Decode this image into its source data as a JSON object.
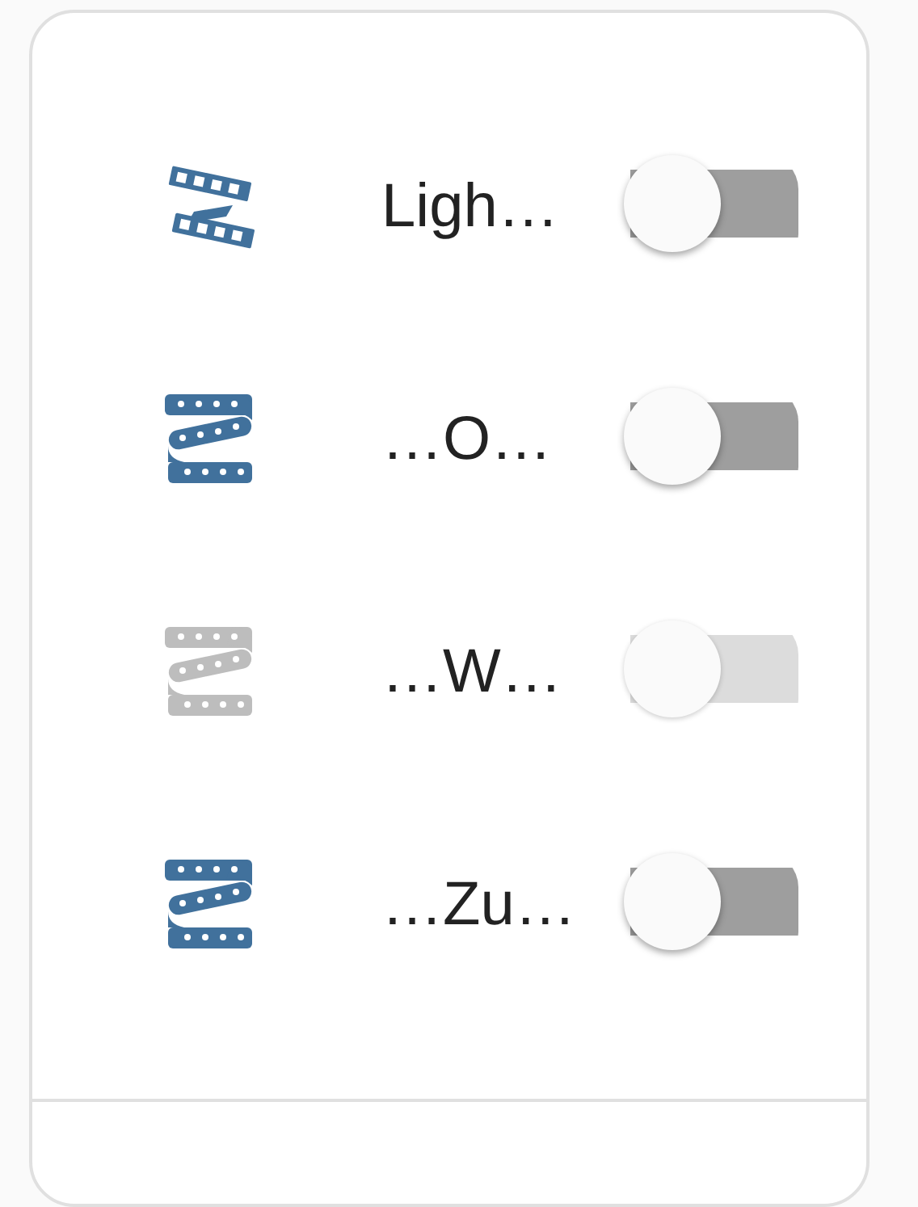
{
  "rows": [
    {
      "kind": "film",
      "label": "Ligh…",
      "on": false,
      "disabled": false
    },
    {
      "kind": "pickup",
      "label": "…O…",
      "on": false,
      "disabled": false
    },
    {
      "kind": "pickup",
      "label": "…W…",
      "on": false,
      "disabled": true
    },
    {
      "kind": "pickup",
      "label": "…Zu…",
      "on": false,
      "disabled": false
    }
  ]
}
